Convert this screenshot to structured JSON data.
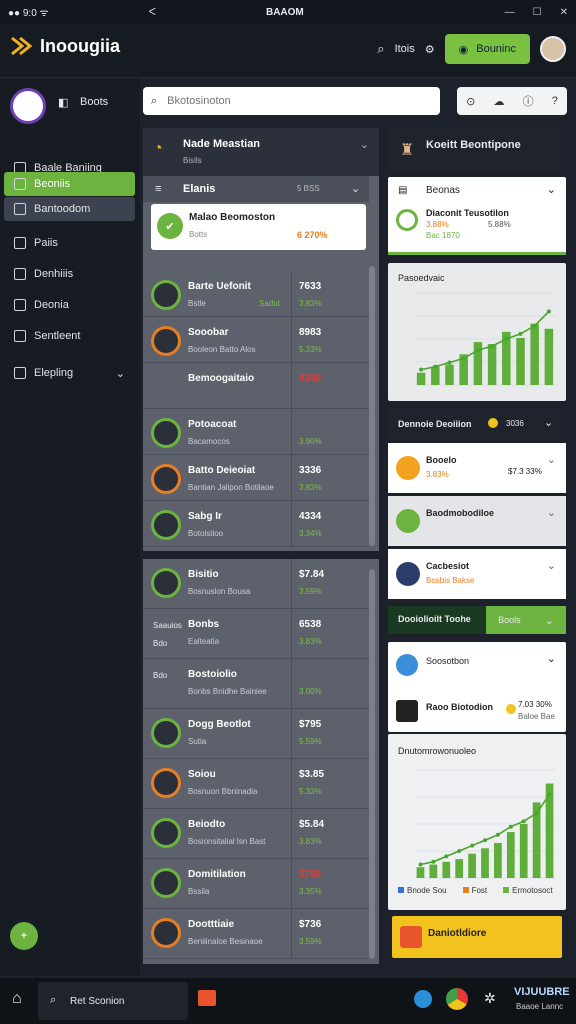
{
  "statusbar": {
    "left": "●● 9:0 ᯤ",
    "center_glyph": "ᐸ",
    "title": "BAAOM"
  },
  "header": {
    "app_name": "Inoougiia",
    "link": "Itois",
    "cta": "Bouninc"
  },
  "sidebar": {
    "profile_label": "Boots",
    "items": [
      {
        "label": "Baale Baniing",
        "state": "normal"
      },
      {
        "label": "Beoniis",
        "state": "active"
      },
      {
        "label": "Bantoodom",
        "state": "selected"
      },
      {
        "label": "Paiis",
        "state": "normal"
      },
      {
        "label": "Denhiiis",
        "state": "normal"
      },
      {
        "label": "Deonia",
        "state": "normal"
      },
      {
        "label": "Sentleent",
        "state": "normal"
      },
      {
        "label": "Elepling",
        "state": "normal"
      }
    ]
  },
  "search": {
    "placeholder": "Bkotosinoton"
  },
  "mid": {
    "top_title": "Nade Meastian",
    "top_sub": "Bisils",
    "section_label": "Elanis",
    "section_value": "5 BSS",
    "highlight": {
      "title": "Malao Beomoston",
      "sub": "Botts",
      "value": "6 270%"
    },
    "rows": [
      {
        "title": "Barte Uefonit",
        "sub": "Bstle",
        "v1": "7633",
        "v2": "3.83%",
        "v3": "Sadut",
        "icon": "check-icon"
      },
      {
        "title": "Sooobar",
        "sub": "Booleon Batto Alos",
        "v1": "8983",
        "v2": "5.33%",
        "icon": "star-icon"
      },
      {
        "title": "Bemoogaitaio",
        "sub": "",
        "v1": "4390",
        "v2": "",
        "icon": ""
      },
      {
        "title": "Potoacoat",
        "sub": "Bacamocos",
        "v1": "",
        "v2": "3.90%",
        "icon": "grid-icon"
      },
      {
        "title": "Batto Deieoiat",
        "sub": "Bantian Jalipon Botilaoe",
        "v1": "3336",
        "v2": "3.83%",
        "icon": "person-icon"
      },
      {
        "title": "Sabg Ir",
        "sub": "Botolstioo",
        "v1": "4334",
        "v2": "3.34%",
        "icon": "phone-icon"
      }
    ],
    "rows2": [
      {
        "title": "Bisitio",
        "sub": "Bosnuslon Bousa",
        "v1": "$7.84",
        "v2": "3.59%",
        "icon": "chart-icon"
      },
      {
        "title": "Bonbs",
        "sub": "Ealteatia",
        "v1": "6538",
        "v2": "3.83%",
        "pre1": "Saauios",
        "pre2": "Bdo"
      },
      {
        "title": "Bostoiolio",
        "sub": "Bonbs Bnidhe Bainiee",
        "v1": "",
        "v2": "3.00%",
        "pre1": "Bdo"
      },
      {
        "title": "Dogg Beotlot",
        "sub": "Sutia",
        "v1": "$795",
        "v2": "5.59%",
        "icon": "wheel-icon"
      },
      {
        "title": "Soiou",
        "sub": "Bosnuon Bbninadia",
        "v1": "$3.85",
        "v2": "5.33%",
        "icon": "pie-icon"
      },
      {
        "title": "Beiodto",
        "sub": "Bosionsitalial lsn Bast",
        "v1": "$5.84",
        "v2": "3.83%",
        "icon": "check-icon"
      },
      {
        "title": "Domitilation",
        "sub": "Bssila",
        "v1": "$706",
        "v2": "3.35%",
        "icon": "gear-icon"
      },
      {
        "title": "Dootttiaie",
        "sub": "Beniiinaloe Besinaoe",
        "v1": "$736",
        "v2": "3.59%",
        "icon": "ring-icon"
      }
    ]
  },
  "right": {
    "top_title": "Koeitt Beontipone",
    "card1": {
      "title": "Beonas",
      "row_title": "Diaconit Teusotilon",
      "row_sub1": "3.88%",
      "row_sub2": "Bac 1870",
      "row_sub3": "5.88%"
    },
    "chart1": {
      "title": "Pasoedvaic"
    },
    "dd_title": "Dennoie Deoiiion",
    "dd_val": "3036",
    "list": [
      {
        "title": "Booelo",
        "sub": "3.83%",
        "value": "$7.3 33%"
      },
      {
        "title": "Baodmobodiloe",
        "sub": "",
        "value": ""
      },
      {
        "title": "Cacbesiot",
        "sub": "Bosbis Bakse",
        "value": ""
      }
    ],
    "green_bar": {
      "label": "Dooiolioilt Toohe",
      "button": "Bools"
    },
    "card2": {
      "title": "Soosotbon",
      "row_title": "Raoo Biotodion",
      "val": "7.03 30%",
      "val2": "Baloe Bae"
    },
    "chart2": {
      "title": "Dnutomrowonuoleo",
      "leg1": "Bnode Sou",
      "leg2": "Fost",
      "leg3": "Ermotosoct"
    },
    "yellow": {
      "label": "Daniotldiore"
    }
  },
  "taskbar": {
    "search": "Ret Sconion",
    "brand": "VIJUUBRE",
    "brand_sub": "Baaoe Lannc"
  },
  "chart_data": [
    {
      "type": "bar",
      "title": "Pasoedvaic",
      "values": [
        12,
        18,
        20,
        30,
        42,
        40,
        52,
        46,
        60,
        55
      ],
      "line": [
        15,
        18,
        22,
        26,
        34,
        38,
        45,
        50,
        58,
        72
      ],
      "ylim": [
        0,
        90
      ]
    },
    {
      "type": "bar",
      "title": "Dnutomrowonuoleo",
      "values": [
        8,
        10,
        12,
        14,
        18,
        22,
        26,
        34,
        40,
        56,
        70
      ],
      "line": [
        10,
        12,
        16,
        20,
        24,
        28,
        32,
        38,
        42,
        48,
        62
      ],
      "ylim": [
        0,
        80
      ],
      "xlabel": "",
      "ylabel": ""
    }
  ]
}
